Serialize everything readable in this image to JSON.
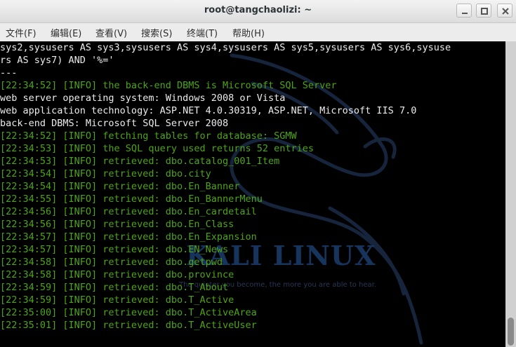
{
  "window": {
    "title": "root@tangchaolizi: ~"
  },
  "menu": [
    "文件(F)",
    "编辑(E)",
    "查看(V)",
    "搜索(S)",
    "终端(T)",
    "帮助(H)"
  ],
  "terminal_lines": [
    {
      "text": "sys2,sysusers AS sys3,sysusers AS sys4,sysusers AS sys5,sysusers AS sys6,sysuse",
      "color": "#ececec"
    },
    {
      "text": "rs AS sys7) AND '%='",
      "color": "#ececec"
    },
    {
      "text": "---",
      "color": "#ececec"
    },
    {
      "text": "[22:34:52] [INFO] the back-end DBMS is Microsoft SQL Server",
      "color": "#4ea514"
    },
    {
      "text": "web server operating system: Windows 2008 or Vista",
      "color": "#ececec"
    },
    {
      "text": "web application technology: ASP.NET 4.0.30319, ASP.NET, Microsoft IIS 7.0",
      "color": "#ececec"
    },
    {
      "text": "back-end DBMS: Microsoft SQL Server 2008",
      "color": "#ececec"
    },
    {
      "text": "[22:34:52] [INFO] fetching tables for database: SGMW",
      "color": "#4ea514"
    },
    {
      "text": "[22:34:53] [INFO] the SQL query used returns 52 entries",
      "color": "#4ea514"
    },
    {
      "text": "[22:34:53] [INFO] retrieved: dbo.catalog_001_Item",
      "color": "#4ea514"
    },
    {
      "text": "[22:34:54] [INFO] retrieved: dbo.city",
      "color": "#4ea514"
    },
    {
      "text": "[22:34:54] [INFO] retrieved: dbo.En_Banner",
      "color": "#4ea514"
    },
    {
      "text": "[22:34:55] [INFO] retrieved: dbo.En_BannerMenu",
      "color": "#4ea514"
    },
    {
      "text": "[22:34:56] [INFO] retrieved: dbo.En_cardetail",
      "color": "#4ea514"
    },
    {
      "text": "[22:34:56] [INFO] retrieved: dbo.En_Class",
      "color": "#4ea514"
    },
    {
      "text": "[22:34:57] [INFO] retrieved: dbo.En_Expansion",
      "color": "#4ea514"
    },
    {
      "text": "[22:34:57] [INFO] retrieved: dbo.EN_News",
      "color": "#4ea514"
    },
    {
      "text": "[22:34:58] [INFO] retrieved: dbo.getpwd",
      "color": "#4ea514"
    },
    {
      "text": "[22:34:58] [INFO] retrieved: dbo.province",
      "color": "#4ea514"
    },
    {
      "text": "[22:34:59] [INFO] retrieved: dbo.T_About",
      "color": "#4ea514"
    },
    {
      "text": "[22:34:59] [INFO] retrieved: dbo.T_Active",
      "color": "#4ea514"
    },
    {
      "text": "[22:35:00] [INFO] retrieved: dbo.T_ActiveArea",
      "color": "#4ea514"
    },
    {
      "text": "[22:35:01] [INFO] retrieved: dbo.T_ActiveUser",
      "color": "#4ea514"
    }
  ],
  "watermark": {
    "title": "KALI LINUX",
    "quote": "The quieter you become, the more you are able to hear."
  },
  "icons": {
    "minimize": "minimize-icon",
    "maximize": "maximize-icon",
    "close": "close-icon"
  }
}
